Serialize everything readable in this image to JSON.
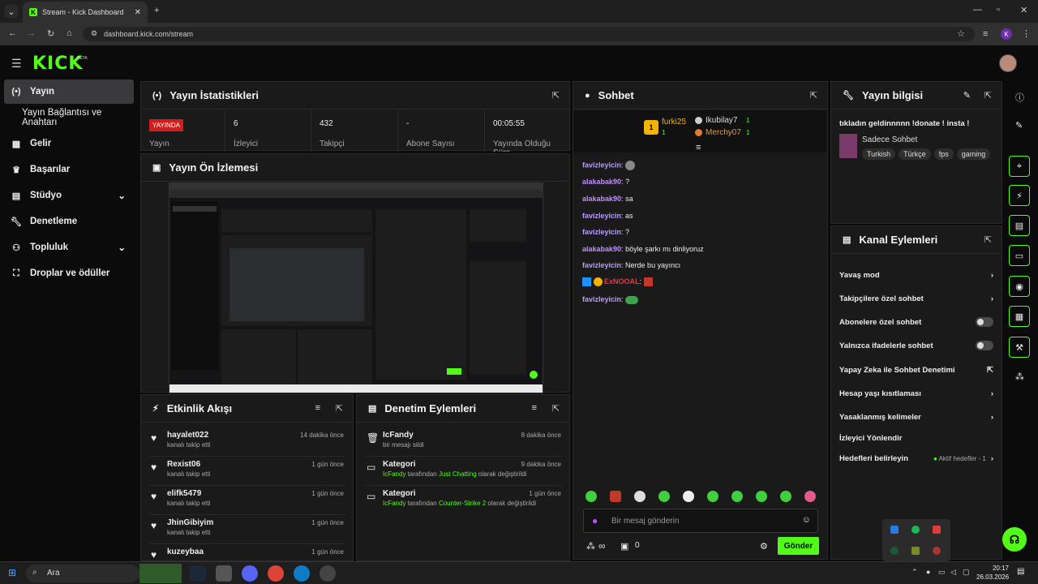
{
  "browser": {
    "tab_title": "Stream - Kick Dashboard",
    "url": "dashboard.kick.com/stream",
    "profile_letter": "K"
  },
  "brand": {
    "logo": "KICK",
    "badge": "BETA",
    "accent": "#53fc18"
  },
  "sidebar": {
    "items": [
      {
        "label": "Yayın",
        "icon": "broadcast-icon"
      },
      {
        "label": "Yayın Bağlantısı ve Anahtarı",
        "icon": ""
      },
      {
        "label": "Gelir",
        "icon": "dashboard-icon"
      },
      {
        "label": "Başarılar",
        "icon": "trophy-icon"
      },
      {
        "label": "Stüdyo",
        "icon": "studio-icon"
      },
      {
        "label": "Denetleme",
        "icon": "wrench-icon"
      },
      {
        "label": "Topluluk",
        "icon": "community-icon"
      },
      {
        "label": "Droplar ve ödüller",
        "icon": "drops-icon"
      }
    ]
  },
  "stats": {
    "title": "Yayın İstatistikleri",
    "live_badge": "YAYINDA",
    "items": [
      {
        "label": "Yayın",
        "value": ""
      },
      {
        "label": "İzleyici",
        "value": "6"
      },
      {
        "label": "Takipçi",
        "value": "432"
      },
      {
        "label": "Abone Sayısı",
        "value": "-"
      },
      {
        "label": "Yayında Olduğu Süre",
        "value": "00:05:55"
      }
    ]
  },
  "preview": {
    "title": "Yayın Ön İzlemesi"
  },
  "activity": {
    "title": "Etkinlik Akışı",
    "rows": [
      {
        "name": "hayalet022",
        "sub": "kanalı takip etti",
        "time": "14 dakika önce"
      },
      {
        "name": "Rexist06",
        "sub": "kanalı takip etti",
        "time": "1 gün önce"
      },
      {
        "name": "elifk5479",
        "sub": "kanalı takip etti",
        "time": "1 gün önce"
      },
      {
        "name": "JhinGibiyim",
        "sub": "kanalı takip etti",
        "time": "1 gün önce"
      },
      {
        "name": "kuzeybaa",
        "sub": "",
        "time": "1 gün önce"
      }
    ]
  },
  "moderation": {
    "title": "Denetim Eylemleri",
    "rows": [
      {
        "name": "IcFandy",
        "sub": "bir mesajı sildi",
        "time": "8 dakika önce"
      },
      {
        "name": "Kategori",
        "sub_user": "IcFandy",
        "sub_mid": " tarafından ",
        "sub_cat": "Just Chatting",
        "sub_end": " olarak değiştirildi",
        "time": "9 dakika önce"
      },
      {
        "name": "Kategori",
        "sub_user": "IcFandy",
        "sub_mid": " tarafından ",
        "sub_cat": "Counter-Strike 2",
        "sub_end": " olarak değiştirildi",
        "time": "1 gün önce"
      }
    ]
  },
  "chat": {
    "title": "Sohbet",
    "leaders": [
      {
        "name": "furki25",
        "count": "1"
      },
      {
        "name": "Ikubilay7",
        "count": "1"
      },
      {
        "name": "Merchy07",
        "count": "1"
      }
    ],
    "messages": [
      {
        "user": "favizleyicin",
        "text": ""
      },
      {
        "user": "alakabak90",
        "text": "?"
      },
      {
        "user": "alakabak90",
        "text": "sa"
      },
      {
        "user": "favizleyicin",
        "text": "as"
      },
      {
        "user": "favizleyicin",
        "text": "?"
      },
      {
        "user": "alakabak90",
        "text": "böyle şarkı mı dinliyoruz"
      },
      {
        "user": "favizleyicin",
        "text": "Nerde bu yayıncı"
      },
      {
        "user": "ExNOOAL",
        "text": ""
      },
      {
        "user": "favizleyicin",
        "text": ""
      }
    ],
    "input_placeholder": "Bir mesaj gönderin",
    "viewers": "∞",
    "count": "0",
    "send": "Gönder"
  },
  "info": {
    "title": "Yayın bilgisi",
    "stream_title": "tıkladın geldinnnnn !donate ! insta !",
    "category": "Sadece Sohbet",
    "tags": [
      "Turkish",
      "Türkçe",
      "fps",
      "gaming"
    ]
  },
  "actions": {
    "title": "Kanal Eylemleri",
    "items": [
      {
        "label": "Yavaş mod",
        "control": "chevron"
      },
      {
        "label": "Takipçilere özel sohbet",
        "control": "chevron"
      },
      {
        "label": "Abonelere özel sohbet",
        "control": "toggle"
      },
      {
        "label": "Yalnızca ifadelerle sohbet",
        "control": "toggle"
      },
      {
        "label": "Yapay Zeka ile Sohbet Denetimi",
        "control": "external"
      },
      {
        "label": "Hesap yaşı kısıtlaması",
        "control": "chevron"
      },
      {
        "label": "Yasaklanmış kelimeler",
        "control": "chevron"
      },
      {
        "label": "İzleyici Yönlendir",
        "control": ""
      },
      {
        "label": "Hedefleri belirleyin",
        "control": "chevron",
        "extra": "Aktif hedefler - 1"
      }
    ]
  },
  "taskbar": {
    "search": "Ara",
    "time": "20:17",
    "date": "26.03.2026"
  }
}
